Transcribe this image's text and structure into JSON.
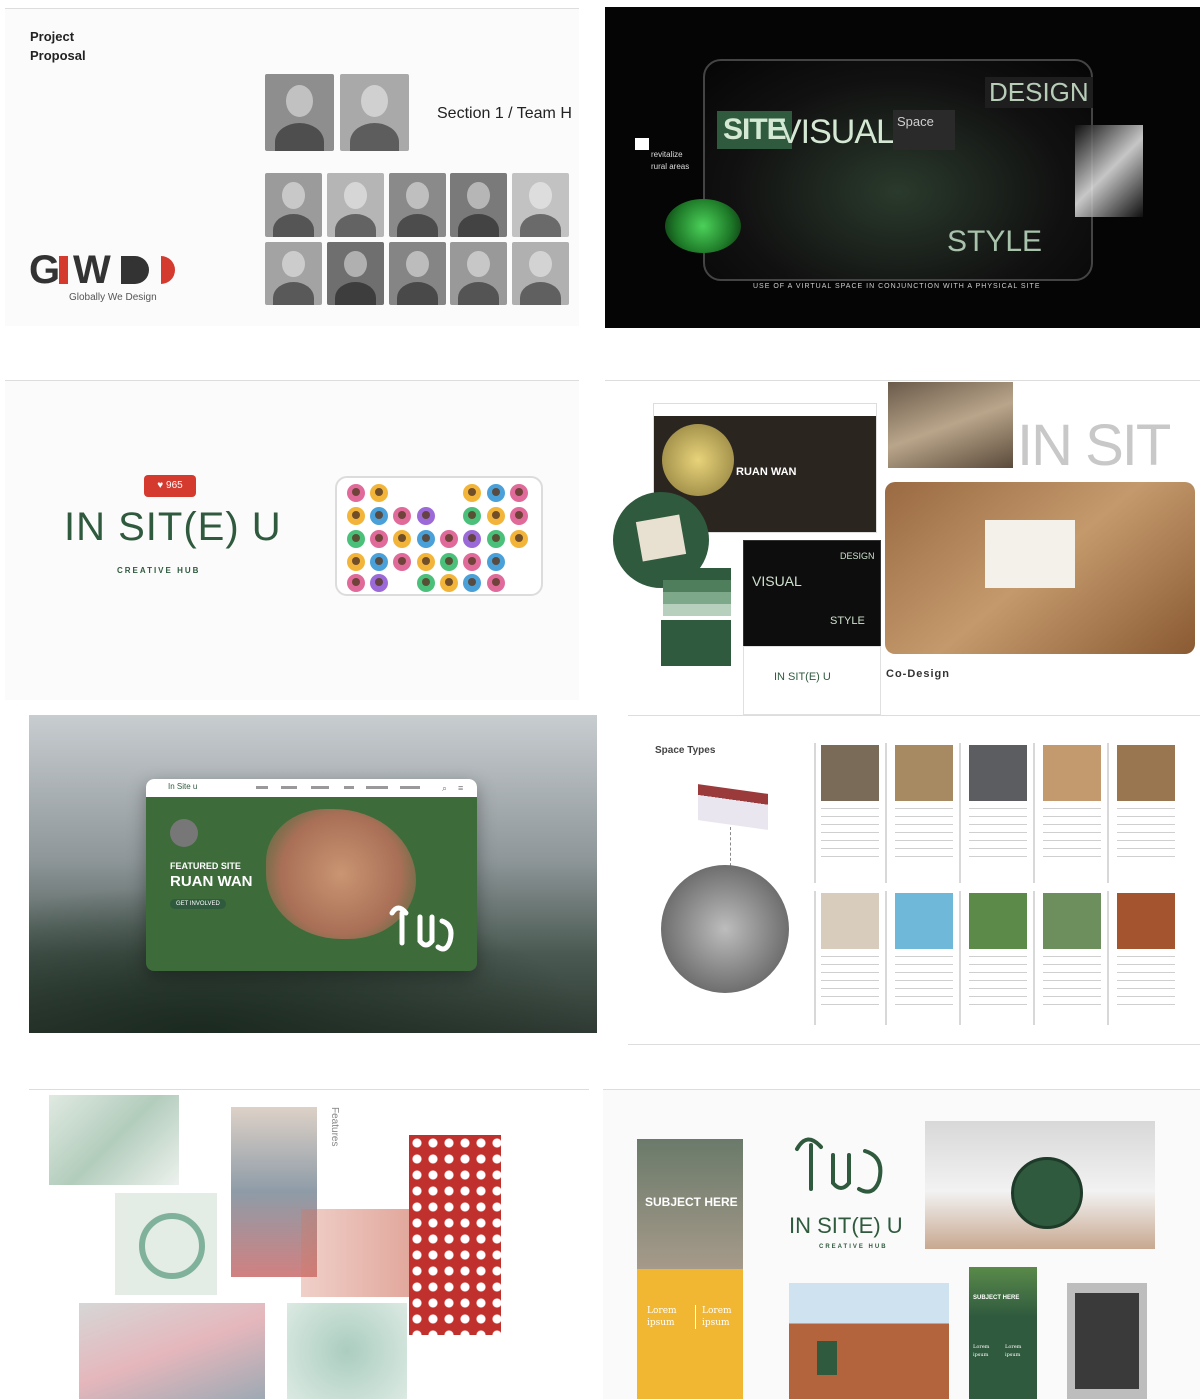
{
  "tile1": {
    "title_line1": "Project",
    "title_line2": "Proposal",
    "section_label": "Section 1 / Team H",
    "logo_text": "GIWD",
    "logo_tagline": "Globally We Design"
  },
  "tile2": {
    "word_site": "SITE",
    "word_visual": "VISUAL",
    "word_space": "Space",
    "word_design": "DESIGN",
    "word_style": "STYLE",
    "side_note_line1": "revitalize",
    "side_note_line2": "rural areas",
    "caption": "USE OF A VIRTUAL SPACE IN CONJUNCTION WITH A PHYSICAL SITE"
  },
  "tile3": {
    "like_count": "965",
    "brand_name": "IN SIT(E) U",
    "brand_sub": "CREATIVE HUB"
  },
  "tile4": {
    "card_title": "RUAN WAN",
    "big_text": "IN SIT",
    "word_visual": "VISUAL",
    "word_design": "DESIGN",
    "word_style": "STYLE",
    "brand_small": "IN SIT(E) U",
    "label": "Co-Design"
  },
  "tile5": {
    "brand": "In Site u",
    "featured_label": "FEATURED SITE",
    "featured_title": "RUAN WAN",
    "button_label": "GET INVOLVED"
  },
  "tile6": {
    "heading": "Space Types",
    "colors": {
      "row1": [
        "#7a6a58",
        "#a88a62",
        "#5c5d60",
        "#c39a6d",
        "#9a7650"
      ],
      "row2": [
        "#d8cdbd",
        "#6fb8d9",
        "#5c8a48",
        "#6d8f5e",
        "#a4552f"
      ]
    }
  },
  "tile7": {
    "vertical_label": "Features"
  },
  "tile8": {
    "poster_title": "SUBJECT HERE",
    "lorem_1": "Lorem ipsum",
    "lorem_2": "Lorem ipsum",
    "brand_name": "IN SIT(E) U",
    "brand_sub": "CREATIVE HUB",
    "banner_title": "SUBJECT HERE",
    "banner_lorem_1": "Lorem ipsum",
    "banner_lorem_2": "Lorem ipsum"
  },
  "palette": {
    "green_dark": "#2f5a3e",
    "green_accent": "#4cd15a",
    "red_accent": "#d53a2f",
    "mustard": "#e8b335"
  }
}
